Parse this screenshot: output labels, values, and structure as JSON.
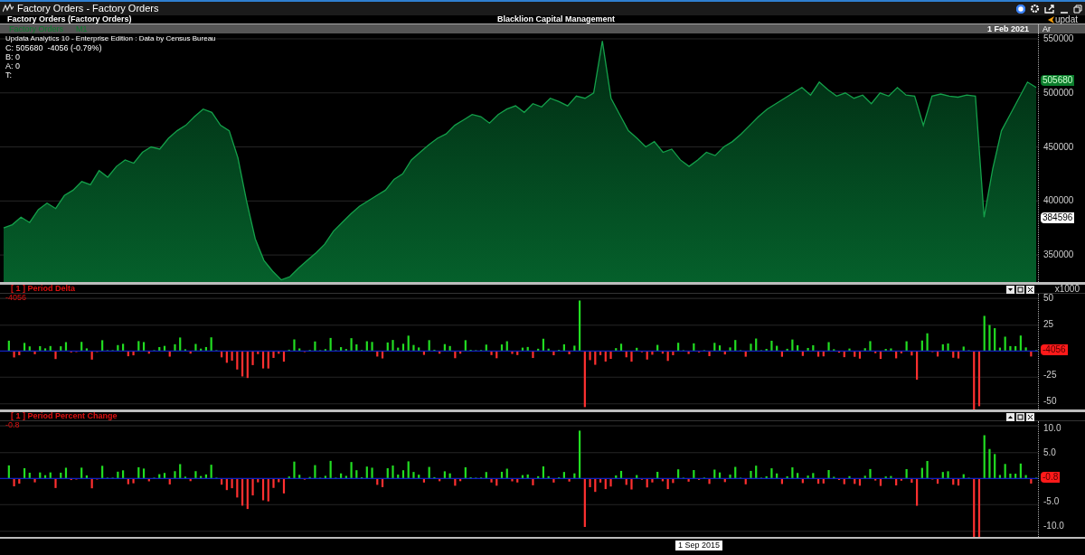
{
  "window": {
    "title": "Factory Orders - Factory Orders"
  },
  "header": {
    "chart_title": "Factory Orders (Factory Orders)",
    "company": "Blacklion Capital Management",
    "logo_text": "updat"
  },
  "main_panel": {
    "period": "M1",
    "date": "1 Feb 2021",
    "axis_label": "Ar",
    "info_lines": [
      "Updata Analytics 10 - Enterprise Edition : Data by Census Bureau",
      "C: 505680  -4056 (-0.79%)",
      "B: 0",
      "A: 0",
      "T:"
    ],
    "last_value": "505680",
    "marker_value": "384596",
    "chart_data": {
      "type": "area",
      "grid": true,
      "ylim": [
        325000,
        555000
      ],
      "yticks": [
        550000,
        500000,
        450000,
        400000,
        350000
      ],
      "series": [
        {
          "name": "Factory Orders",
          "color": "#14a04a",
          "values": [
            375000,
            378000,
            385000,
            380000,
            392000,
            398000,
            393000,
            405000,
            410000,
            418000,
            415000,
            428000,
            422000,
            432000,
            438000,
            435000,
            445000,
            450000,
            448000,
            458000,
            465000,
            470000,
            478000,
            485000,
            482000,
            470000,
            465000,
            440000,
            400000,
            365000,
            345000,
            335000,
            327000,
            330000,
            338000,
            345000,
            352000,
            360000,
            372000,
            380000,
            388000,
            395000,
            400000,
            405000,
            410000,
            420000,
            425000,
            438000,
            445000,
            452000,
            458000,
            462000,
            470000,
            475000,
            480000,
            478000,
            472000,
            480000,
            485000,
            488000,
            482000,
            490000,
            487000,
            495000,
            492000,
            488000,
            497000,
            495000,
            500000,
            548000,
            495000,
            480000,
            465000,
            458000,
            450000,
            455000,
            445000,
            448000,
            438000,
            432000,
            438000,
            445000,
            442000,
            450000,
            455000,
            462000,
            470000,
            478000,
            485000,
            490000,
            495000,
            500000,
            505000,
            498000,
            510000,
            503000,
            497000,
            500000,
            495000,
            498000,
            490000,
            500000,
            497000,
            505000,
            498000,
            497000,
            470000,
            497000,
            499000,
            497000,
            496000,
            498000,
            497000,
            385000,
            430000,
            465000,
            480000,
            495000,
            510000,
            505000
          ]
        }
      ]
    }
  },
  "delta_panel": {
    "title": "[ 1 ] Period Delta",
    "value": "-4056",
    "scale": "x1000",
    "yticks": [
      "50",
      "25",
      "-25",
      "-50"
    ],
    "last_value": "-4056"
  },
  "percent_panel": {
    "title": "[ 1 ] Period Percent Change",
    "value": "-0.8",
    "yticks": [
      "10.0",
      "5.0",
      "-5.0",
      "-10.0"
    ],
    "last_value": "-0.8"
  },
  "time_axis": {
    "cursor_date": "1 Sep 2015"
  }
}
